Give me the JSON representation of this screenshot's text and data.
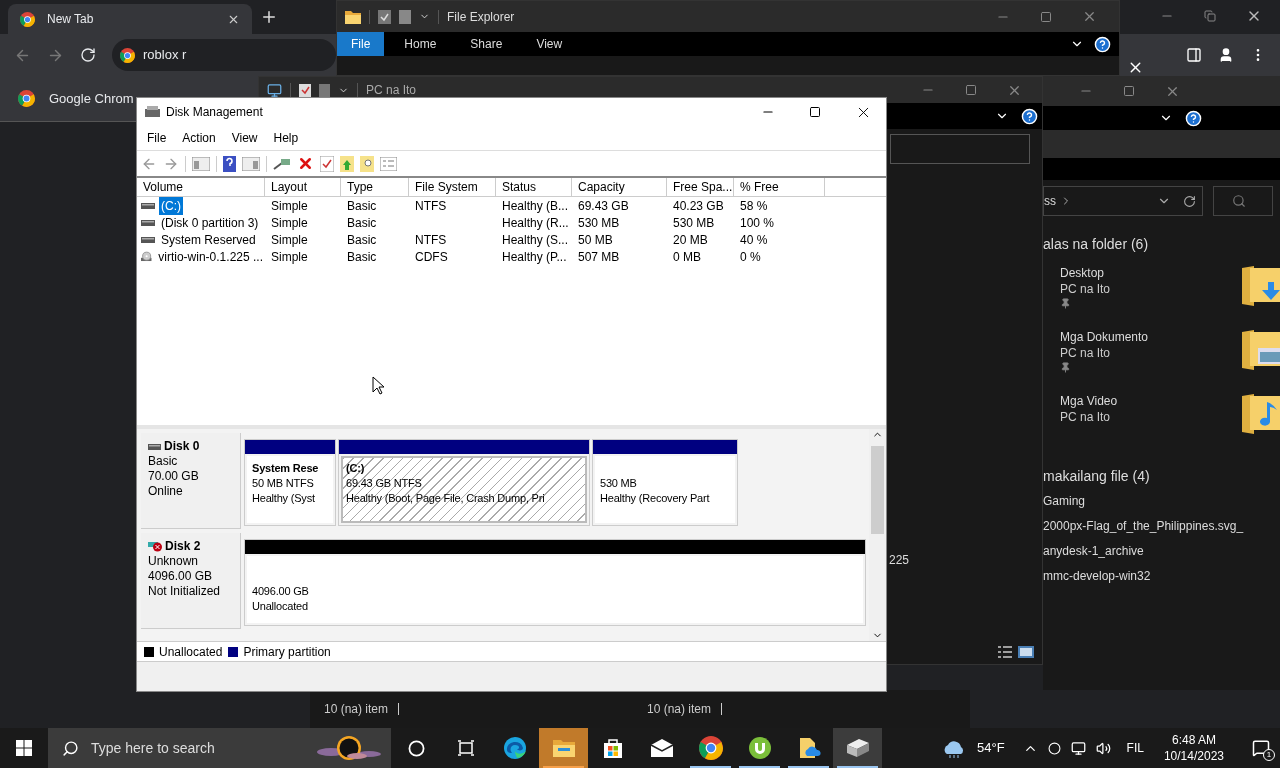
{
  "browser": {
    "tab": {
      "title": "New Tab"
    },
    "address": "roblox r",
    "infobar": "Google Chrom"
  },
  "explorer_main": {
    "title": "File Explorer",
    "ribbon_tabs": [
      {
        "label": "File",
        "selected": true
      },
      {
        "label": "Home",
        "selected": false
      },
      {
        "label": "Share",
        "selected": false
      },
      {
        "label": "View",
        "selected": false
      }
    ]
  },
  "explorer_pc": {
    "title": "PC na Ito",
    "column_text": "225"
  },
  "explorer_quick": {
    "breadcrumb": "ss",
    "folders_group": "alas na folder (6)",
    "folders": [
      {
        "name": "Desktop",
        "location": "PC na Ito",
        "pinned": true,
        "kind": "download"
      },
      {
        "name": "Mga Dokumento",
        "location": "PC na Ito",
        "pinned": true,
        "kind": "pictures"
      },
      {
        "name": "Mga Video",
        "location": "PC na Ito",
        "pinned": false,
        "kind": "music"
      }
    ],
    "files_group": "makailang file (4)",
    "files": [
      "Gaming",
      "2000px-Flag_of_the_Philippines.svg_",
      "anydesk-1_archive",
      "mmc-develop-win32"
    ]
  },
  "status_bars": [
    "10 (na) item",
    "10 (na) item"
  ],
  "disk_management": {
    "title": "Disk Management",
    "menu": [
      "File",
      "Action",
      "View",
      "Help"
    ],
    "columns": [
      "Volume",
      "Layout",
      "Type",
      "File System",
      "Status",
      "Capacity",
      "Free Spa...",
      "% Free"
    ],
    "rows": [
      {
        "kind": "disk",
        "selected": true,
        "volume": "(C:)",
        "layout": "Simple",
        "type": "Basic",
        "file_system": "NTFS",
        "status": "Healthy (B...",
        "capacity": "69.43 GB",
        "free_space": "40.23 GB",
        "percent_free": "58 %"
      },
      {
        "kind": "disk",
        "selected": false,
        "volume": "(Disk 0 partition 3)",
        "layout": "Simple",
        "type": "Basic",
        "status": "Healthy (R...",
        "capacity": "530 MB",
        "free_space": "530 MB",
        "percent_free": "100 %"
      },
      {
        "kind": "disk",
        "selected": false,
        "volume": "System Reserved",
        "layout": "Simple",
        "type": "Basic",
        "file_system": "NTFS",
        "status": "Healthy (S...",
        "capacity": "50 MB",
        "free_space": "20 MB",
        "percent_free": "40 %"
      },
      {
        "kind": "cd",
        "selected": false,
        "volume": "virtio-win-0.1.225 ...",
        "layout": "Simple",
        "type": "Basic",
        "file_system": "CDFS",
        "status": "Healthy (P...",
        "capacity": "507 MB",
        "free_space": "0 MB",
        "percent_free": "0 %"
      }
    ],
    "disks": [
      {
        "name": "Disk 0",
        "type": "Basic",
        "size": "70.00 GB",
        "status": "Online",
        "initialized": true,
        "partitions": [
          {
            "kind": "primary",
            "selected": false,
            "name": "System Rese",
            "size": "50 MB NTFS",
            "status": "Healthy (Syst"
          },
          {
            "kind": "primary",
            "selected": true,
            "name": "(C:)",
            "size": "69.43 GB NTFS",
            "status": "Healthy (Boot, Page File, Crash Dump, Pri"
          },
          {
            "kind": "primary",
            "selected": false,
            "size": "530 MB",
            "status": "Healthy (Recovery Part"
          }
        ]
      },
      {
        "name": "Disk 2",
        "type": "Unknown",
        "size": "4096.00 GB",
        "status": "Not Initialized",
        "initialized": false,
        "partitions": [
          {
            "kind": "unallocated",
            "selected": false,
            "size": "4096.00 GB",
            "status": "Unallocated"
          }
        ]
      }
    ],
    "legend": [
      {
        "label": "Unallocated",
        "color": "#000000"
      },
      {
        "label": "Primary partition",
        "color": "#000080"
      }
    ]
  },
  "taskbar": {
    "search_placeholder": "Type here to search",
    "apps": [
      {
        "kind": "cortana",
        "running": false,
        "selected": false,
        "flashing": false
      },
      {
        "kind": "task_view",
        "running": false,
        "selected": false,
        "flashing": false
      },
      {
        "kind": "edge",
        "running": false,
        "selected": false,
        "flashing": false
      },
      {
        "kind": "explorer",
        "running": true,
        "selected": false,
        "flashing": true
      },
      {
        "kind": "store",
        "running": false,
        "selected": false,
        "flashing": false
      },
      {
        "kind": "mail",
        "running": false,
        "selected": false,
        "flashing": false
      },
      {
        "kind": "chrome",
        "running": true,
        "selected": false,
        "flashing": false
      },
      {
        "kind": "utorrent",
        "running": true,
        "selected": false,
        "flashing": false
      },
      {
        "kind": "cloud_file",
        "running": true,
        "selected": false,
        "flashing": false
      },
      {
        "kind": "disk_manager",
        "running": true,
        "selected": true,
        "flashing": false
      }
    ],
    "weather": "54°F",
    "language": "FIL",
    "time": "6:48 AM",
    "date": "10/14/2023",
    "notifications": "1"
  }
}
